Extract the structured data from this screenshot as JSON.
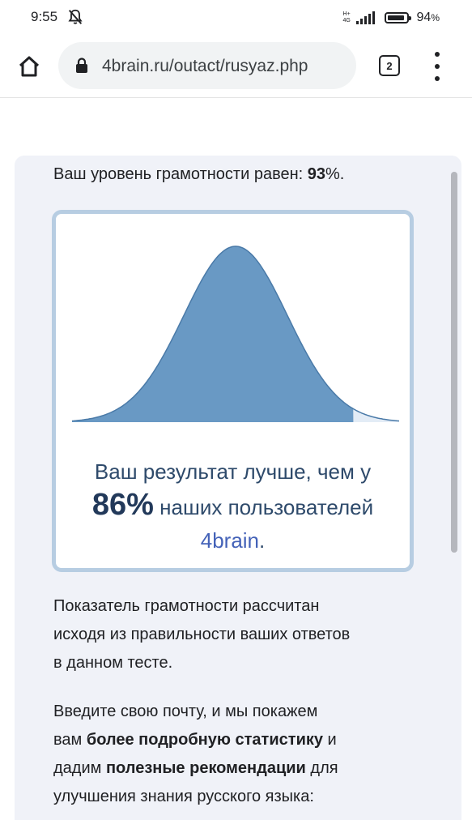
{
  "status_bar": {
    "time": "9:55",
    "network": "H+",
    "network_sub": "4G",
    "battery_percent": "94",
    "battery_suffix": "%",
    "battery_level": 0.94
  },
  "browser": {
    "url": "4brain.ru/outact/rusyaz.php",
    "tab_count": "2"
  },
  "result": {
    "level_prefix": "Ваш уровень грамотности равен: ",
    "level_value": "93",
    "level_suffix": "%.",
    "curve_fill_fraction": 0.86,
    "line1": "Ваш результат лучше, чем у",
    "percent": "86%",
    "line2_rest": " наших пользователей",
    "brand": "4brain",
    "brand_suffix": "."
  },
  "explanation": [
    "Показатель грамотности рассчитан",
    "исходя из правильности ваших ответов",
    "в данном тесте."
  ],
  "offer": {
    "line1": "Введите свою почту, и мы покажем",
    "line2_a": "вам ",
    "line2_bold": "более подробную статистику",
    "line2_b": " и",
    "line3_a": "дадим ",
    "line3_bold": "полезные рекомендации",
    "line3_b": " для",
    "line4": "улучшения знания русского языка:"
  },
  "colors": {
    "curve_fill": "#6999c4",
    "curve_tail": "#e3ecf6",
    "curve_line": "#4a7aa8",
    "box_border": "#b7cde2",
    "card_bg": "#f0f2f8",
    "brand_link": "#4462b8"
  }
}
